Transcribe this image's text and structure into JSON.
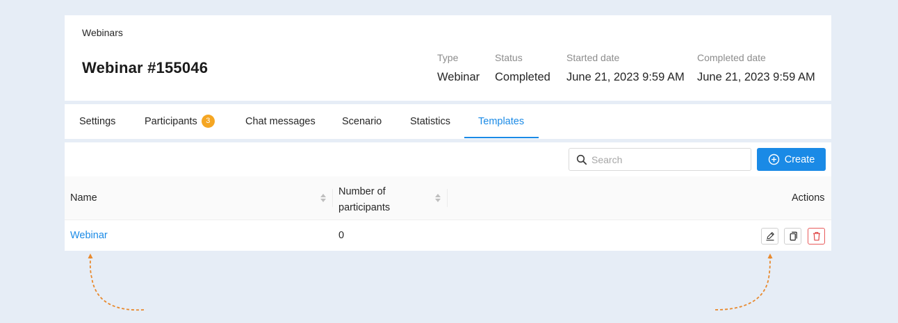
{
  "header": {
    "breadcrumb": "Webinars",
    "title": "Webinar #155046",
    "meta": [
      {
        "label": "Type",
        "value": "Webinar"
      },
      {
        "label": "Status",
        "value": "Completed"
      },
      {
        "label": "Started date",
        "value": "June 21, 2023 9:59 AM"
      },
      {
        "label": "Completed date",
        "value": "June 21, 2023 9:59 AM"
      }
    ]
  },
  "tabs": [
    {
      "label": "Settings"
    },
    {
      "label": "Participants",
      "badge": "3"
    },
    {
      "label": "Chat messages"
    },
    {
      "label": "Scenario"
    },
    {
      "label": "Statistics"
    },
    {
      "label": "Templates",
      "active": true
    }
  ],
  "toolbar": {
    "search_placeholder": "Search",
    "search_value": "",
    "create_label": "Create"
  },
  "table": {
    "columns": {
      "name": "Name",
      "participants_line1": "Number of",
      "participants_line2": "participants",
      "actions": "Actions"
    },
    "rows": [
      {
        "name": "Webinar",
        "participants": "0"
      }
    ]
  },
  "icons": {
    "search": "search-icon",
    "create": "plus-circle-icon",
    "edit": "pencil-icon",
    "copy": "copy-icon",
    "delete": "trash-icon"
  },
  "colors": {
    "accent": "#1a8ae6",
    "badge": "#f5a623",
    "danger": "#e85a5a",
    "annotation_arrow": "#e8892d",
    "background": "#e6edf6"
  }
}
